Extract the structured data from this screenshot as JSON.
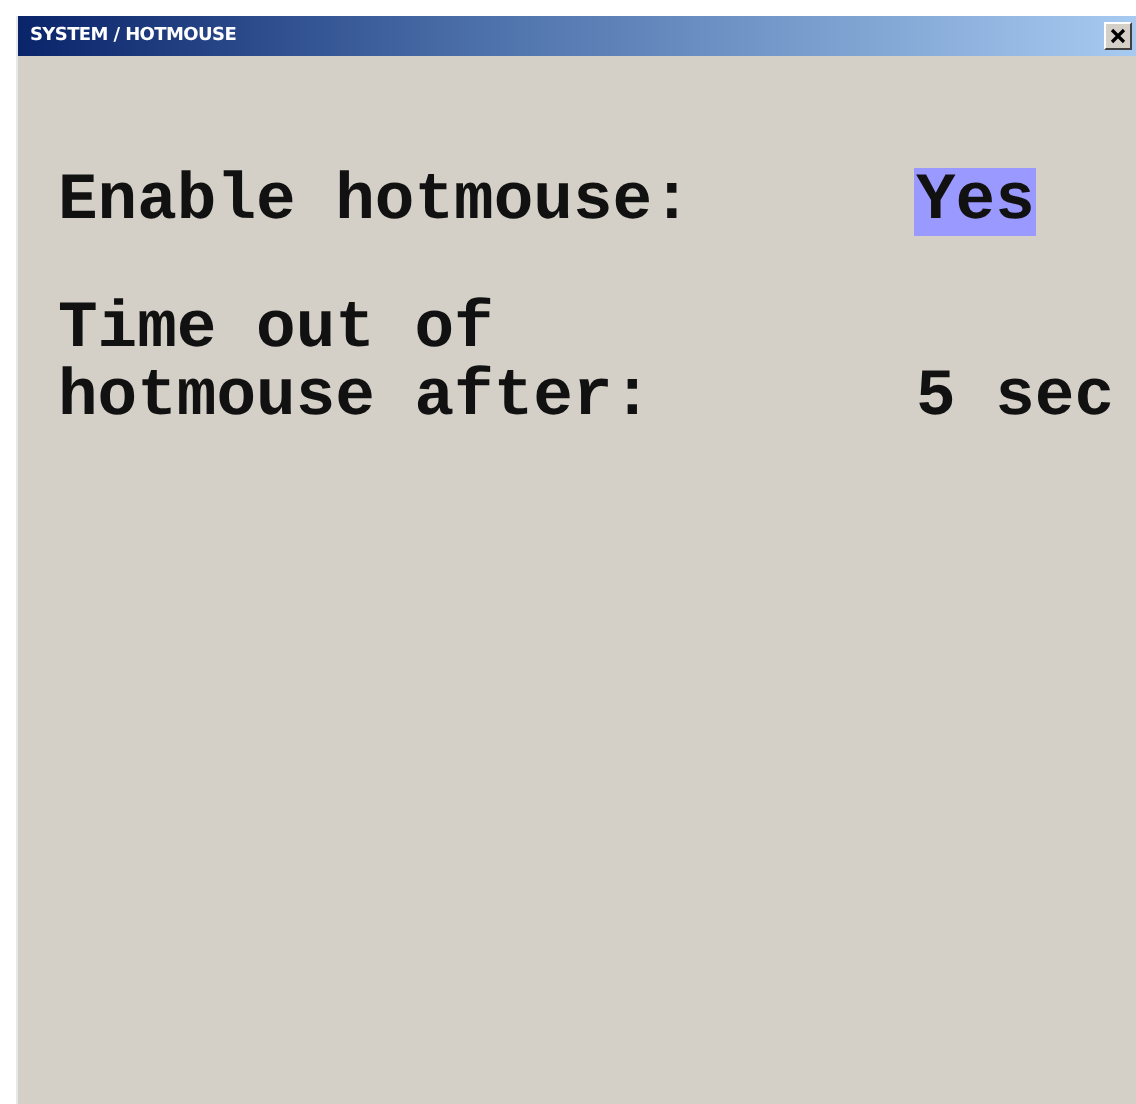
{
  "window": {
    "title": "SYSTEM / HOTMOUSE"
  },
  "settings": [
    {
      "label": "Enable hotmouse:",
      "value": "Yes",
      "selected": true
    },
    {
      "label": "Time out of\nhotmouse after:",
      "value": "5 sec",
      "selected": false
    }
  ]
}
